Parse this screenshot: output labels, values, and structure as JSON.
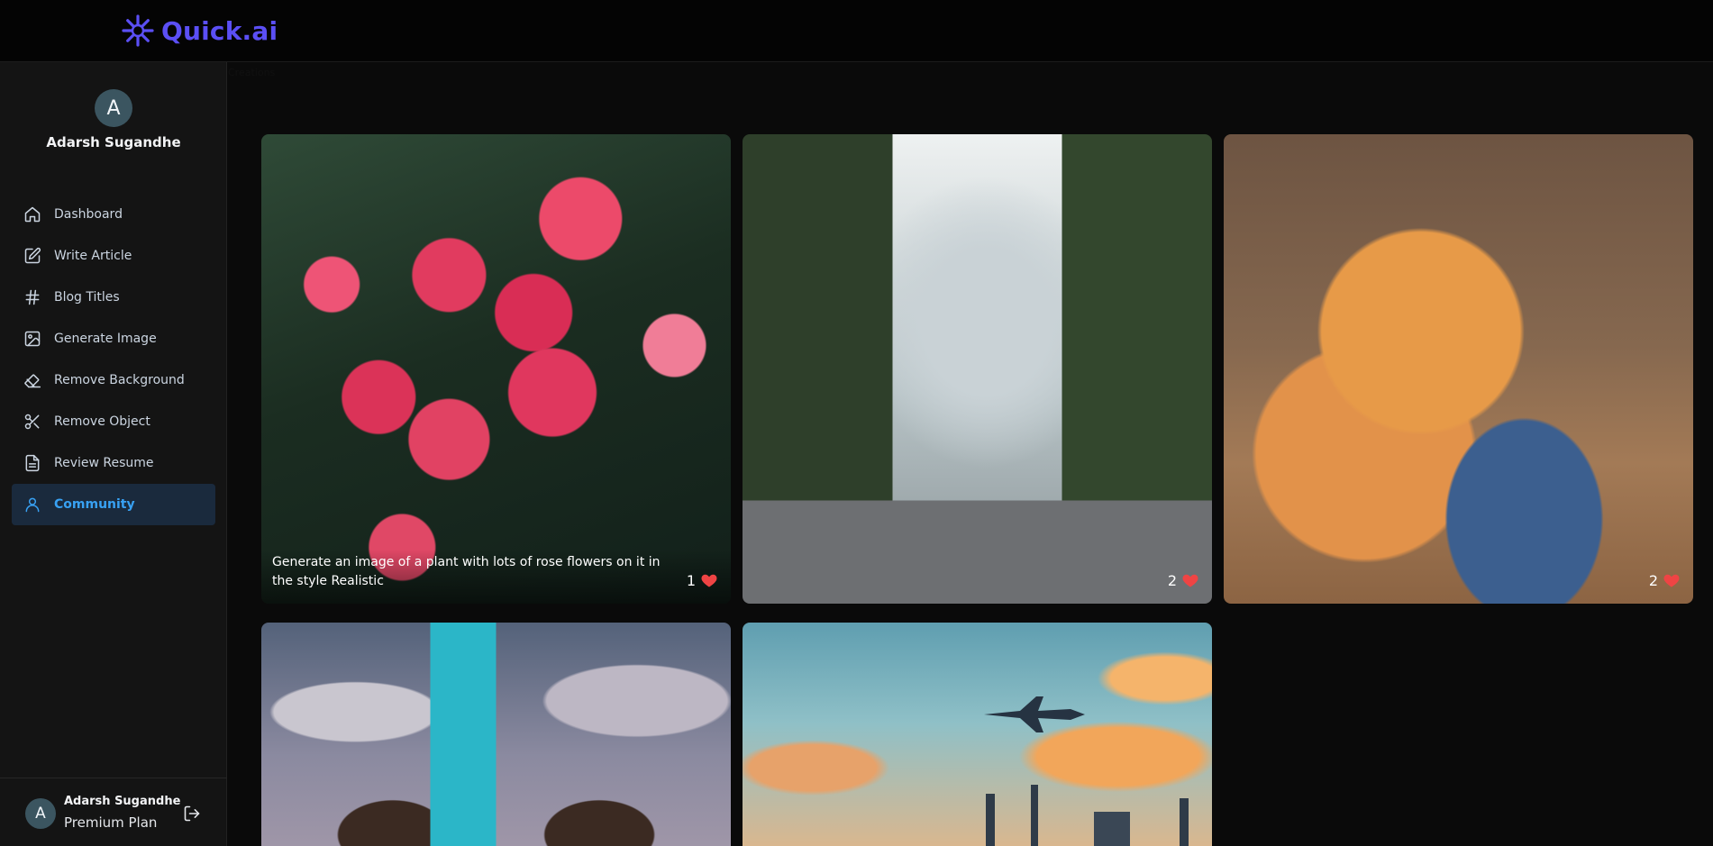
{
  "app": {
    "name": "Quick.ai",
    "brand_color": "#5b4ff5",
    "accent_color": "#38a1f3",
    "like_color": "#ef4444"
  },
  "sidebar": {
    "user": {
      "initial": "A",
      "name": "Adarsh Sugandhe"
    },
    "items": [
      {
        "label": "Dashboard",
        "icon": "house-icon",
        "active": false
      },
      {
        "label": "Write Article",
        "icon": "square-pen-icon",
        "active": false
      },
      {
        "label": "Blog Titles",
        "icon": "hash-icon",
        "active": false
      },
      {
        "label": "Generate Image",
        "icon": "image-icon",
        "active": false
      },
      {
        "label": "Remove Background",
        "icon": "eraser-icon",
        "active": false
      },
      {
        "label": "Remove Object",
        "icon": "scissors-icon",
        "active": false
      },
      {
        "label": "Review Resume",
        "icon": "file-text-icon",
        "active": false
      },
      {
        "label": "Community",
        "icon": "user-icon",
        "active": true
      }
    ],
    "footer": {
      "initial": "A",
      "name": "Adarsh Sugandhe",
      "plan": "Premium Plan"
    }
  },
  "main": {
    "title": "Creations",
    "creations": [
      {
        "prompt": "Generate an image of a plant with lots of rose flowers on it in the style Realistic",
        "likes": "1",
        "image": "roses"
      },
      {
        "prompt": "",
        "likes": "2",
        "image": "city-street"
      },
      {
        "prompt": "",
        "likes": "2",
        "image": "kitten-with-toy-car"
      },
      {
        "prompt": "",
        "likes": "",
        "image": "futuristic-tower-in-clouds"
      },
      {
        "prompt": "",
        "likes": "",
        "image": "jet-over-city-at-sunset"
      }
    ]
  }
}
